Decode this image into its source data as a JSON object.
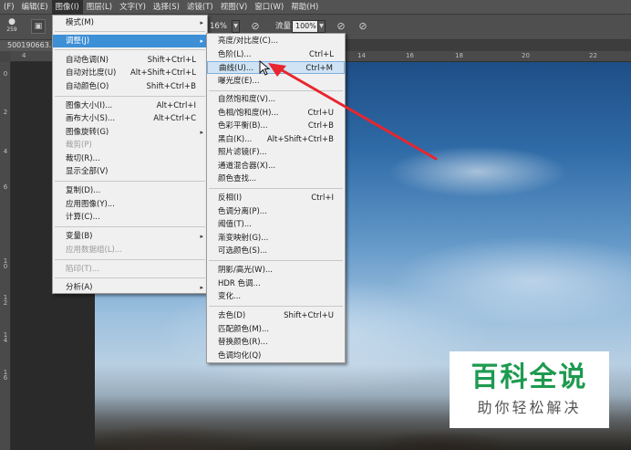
{
  "menubar": {
    "items": [
      "(F)",
      "编辑(E)",
      "图像(I)",
      "图层(L)",
      "文字(Y)",
      "选择(S)",
      "滤镜(T)",
      "视图(V)",
      "窗口(W)",
      "帮助(H)"
    ]
  },
  "options": {
    "brush_size": "259",
    "opacity_value": "16%",
    "flow_label": "流量:",
    "flow_value": "100%",
    "dropdown_arrow": "▼"
  },
  "document": {
    "tab_title": "500190663."
  },
  "rulers": {
    "top": [
      "4",
      "14",
      "16",
      "18",
      "20",
      "22"
    ],
    "left": [
      "0",
      "2",
      "4",
      "6",
      "10",
      "12",
      "14",
      "16"
    ]
  },
  "image_menu": {
    "items": [
      {
        "label": "模式(M)",
        "shortcut": "",
        "submenu": "▸"
      },
      {
        "label": "调整(J)",
        "shortcut": "",
        "submenu": "▸"
      },
      {
        "label": "自动色调(N)",
        "shortcut": "Shift+Ctrl+L"
      },
      {
        "label": "自动对比度(U)",
        "shortcut": "Alt+Shift+Ctrl+L"
      },
      {
        "label": "自动颜色(O)",
        "shortcut": "Shift+Ctrl+B"
      },
      {
        "label": "图像大小(I)...",
        "shortcut": "Alt+Ctrl+I"
      },
      {
        "label": "画布大小(S)...",
        "shortcut": "Alt+Ctrl+C"
      },
      {
        "label": "图像旋转(G)",
        "shortcut": "",
        "submenu": "▸"
      },
      {
        "label": "裁剪(P)",
        "shortcut": ""
      },
      {
        "label": "裁切(R)...",
        "shortcut": ""
      },
      {
        "label": "显示全部(V)",
        "shortcut": ""
      },
      {
        "label": "复制(D)...",
        "shortcut": ""
      },
      {
        "label": "应用图像(Y)...",
        "shortcut": ""
      },
      {
        "label": "计算(C)...",
        "shortcut": ""
      },
      {
        "label": "变量(B)",
        "shortcut": "",
        "submenu": "▸"
      },
      {
        "label": "应用数据组(L)...",
        "shortcut": ""
      },
      {
        "label": "陷印(T)...",
        "shortcut": ""
      },
      {
        "label": "分析(A)",
        "shortcut": "",
        "submenu": "▸"
      }
    ]
  },
  "adjust_menu": {
    "items": [
      {
        "label": "亮度/对比度(C)...",
        "shortcut": ""
      },
      {
        "label": "色阶(L)...",
        "shortcut": "Ctrl+L"
      },
      {
        "label": "曲线(U)...",
        "shortcut": "Ctrl+M"
      },
      {
        "label": "曝光度(E)...",
        "shortcut": ""
      },
      {
        "label": "自然饱和度(V)...",
        "shortcut": ""
      },
      {
        "label": "色相/饱和度(H)...",
        "shortcut": "Ctrl+U"
      },
      {
        "label": "色彩平衡(B)...",
        "shortcut": "Ctrl+B"
      },
      {
        "label": "黑白(K)...",
        "shortcut": "Alt+Shift+Ctrl+B"
      },
      {
        "label": "照片滤镜(F)...",
        "shortcut": ""
      },
      {
        "label": "通道混合器(X)...",
        "shortcut": ""
      },
      {
        "label": "颜色查找...",
        "shortcut": ""
      },
      {
        "label": "反相(I)",
        "shortcut": "Ctrl+I"
      },
      {
        "label": "色调分离(P)...",
        "shortcut": ""
      },
      {
        "label": "阈值(T)...",
        "shortcut": ""
      },
      {
        "label": "渐变映射(G)...",
        "shortcut": ""
      },
      {
        "label": "可选颜色(S)...",
        "shortcut": ""
      },
      {
        "label": "阴影/高光(W)...",
        "shortcut": ""
      },
      {
        "label": "HDR 色调...",
        "shortcut": ""
      },
      {
        "label": "变化...",
        "shortcut": ""
      },
      {
        "label": "去色(D)",
        "shortcut": "Shift+Ctrl+U"
      },
      {
        "label": "匹配颜色(M)...",
        "shortcut": ""
      },
      {
        "label": "替换颜色(R)...",
        "shortcut": ""
      },
      {
        "label": "色调均化(Q)",
        "shortcut": ""
      }
    ]
  },
  "watermark": {
    "title": "百科全说",
    "subtitle": "助你轻松解决"
  },
  "colors": {
    "highlight": "#3d8fd6",
    "annotation_arrow": "#e8262f",
    "watermark_green": "#1d9a4f"
  }
}
